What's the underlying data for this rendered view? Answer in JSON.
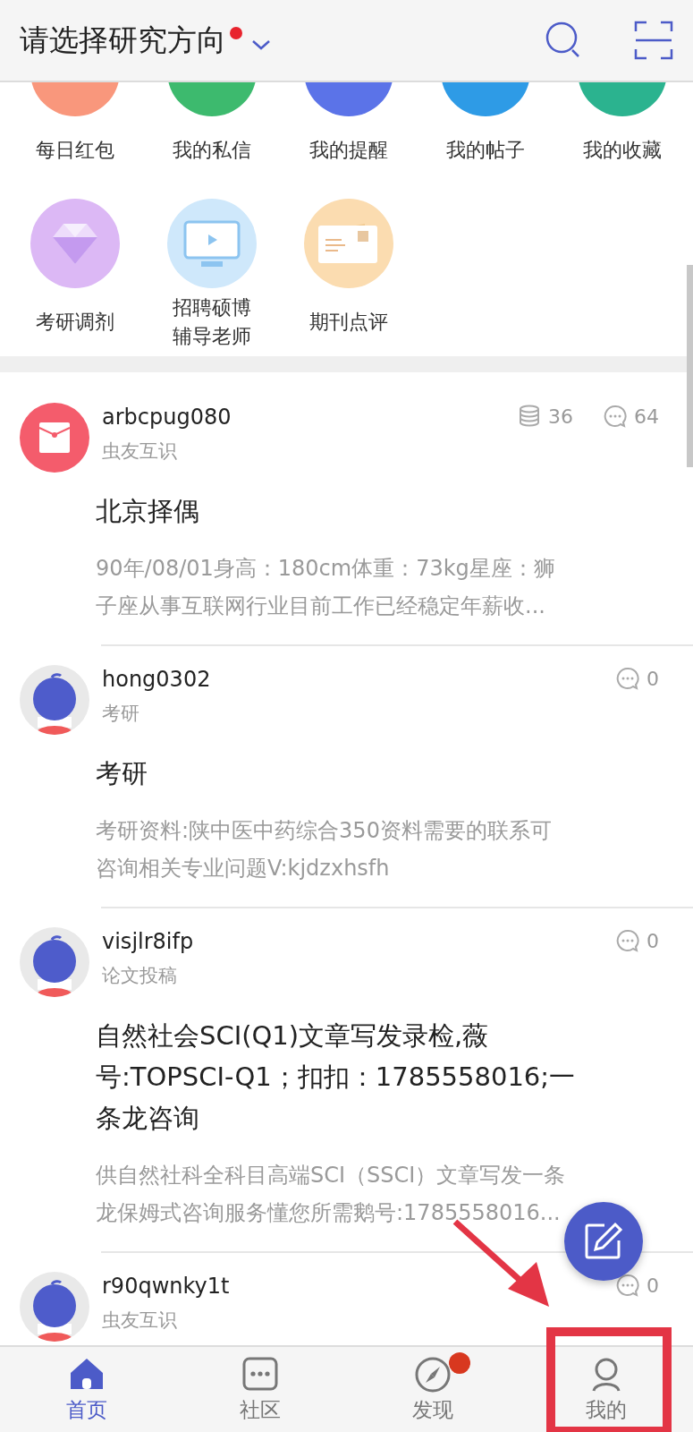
{
  "header": {
    "title": "请选择研究方向",
    "has_dot": true
  },
  "shortcuts": [
    {
      "kind": "red-packet",
      "label": "每日红包"
    },
    {
      "kind": "message",
      "label": "我的私信"
    },
    {
      "kind": "bell",
      "label": "我的提醒"
    },
    {
      "kind": "posts",
      "label": "我的帖子"
    },
    {
      "kind": "star",
      "label": "我的收藏"
    },
    {
      "kind": "diamond",
      "label": "考研调剂"
    },
    {
      "kind": "monitor",
      "label": "招聘硕博辅导老师"
    },
    {
      "kind": "card",
      "label": "期刊点评"
    }
  ],
  "posts": [
    {
      "kind": "red-packet",
      "user": "arbcpug080",
      "tag": "虫友互识",
      "stats": [
        {
          "kind": "coins",
          "value": "36"
        },
        {
          "kind": "comments",
          "value": "64"
        }
      ],
      "title": [
        "北京择偶"
      ],
      "body": [
        "90年/08/01身高：180cm体重：73kg星座：狮",
        "子座从事互联网行业目前工作已经稳定年薪收..."
      ]
    },
    {
      "kind": "default",
      "user": "hong0302",
      "tag": "考研",
      "stats": [
        {
          "kind": "comments",
          "value": "0"
        }
      ],
      "title": [
        "考研"
      ],
      "body": [
        "考研资料:陕中医中药综合350资料需要的联系可",
        "咨询相关专业问题V:kjdzxhsfh"
      ]
    },
    {
      "kind": "default",
      "user": "visjlr8ifp",
      "tag": "论文投稿",
      "stats": [
        {
          "kind": "comments",
          "value": "0"
        }
      ],
      "title": [
        "自然社会SCI(Q1)文章写发录检,薇",
        "号:TOPSCI-Q1；扣扣：1785558016;一",
        "条龙咨询"
      ],
      "body": [
        "供自然社科全科目高端SCI（SSCI）文章写发一条",
        "龙保姆式咨询服务懂您所需鹅号:1785558016..."
      ]
    },
    {
      "kind": "default",
      "user": "r90qwnky1t",
      "tag": "虫友互识",
      "stats": [
        {
          "kind": "comments",
          "value": "0"
        }
      ]
    }
  ],
  "nav": [
    {
      "kind": "home",
      "label": "首页",
      "selected": true,
      "badge": false
    },
    {
      "kind": "chat",
      "label": "社区",
      "selected": false,
      "badge": false
    },
    {
      "kind": "compass",
      "label": "发现",
      "selected": false,
      "badge": true
    },
    {
      "kind": "person",
      "label": "我的",
      "selected": false,
      "badge": false
    }
  ]
}
